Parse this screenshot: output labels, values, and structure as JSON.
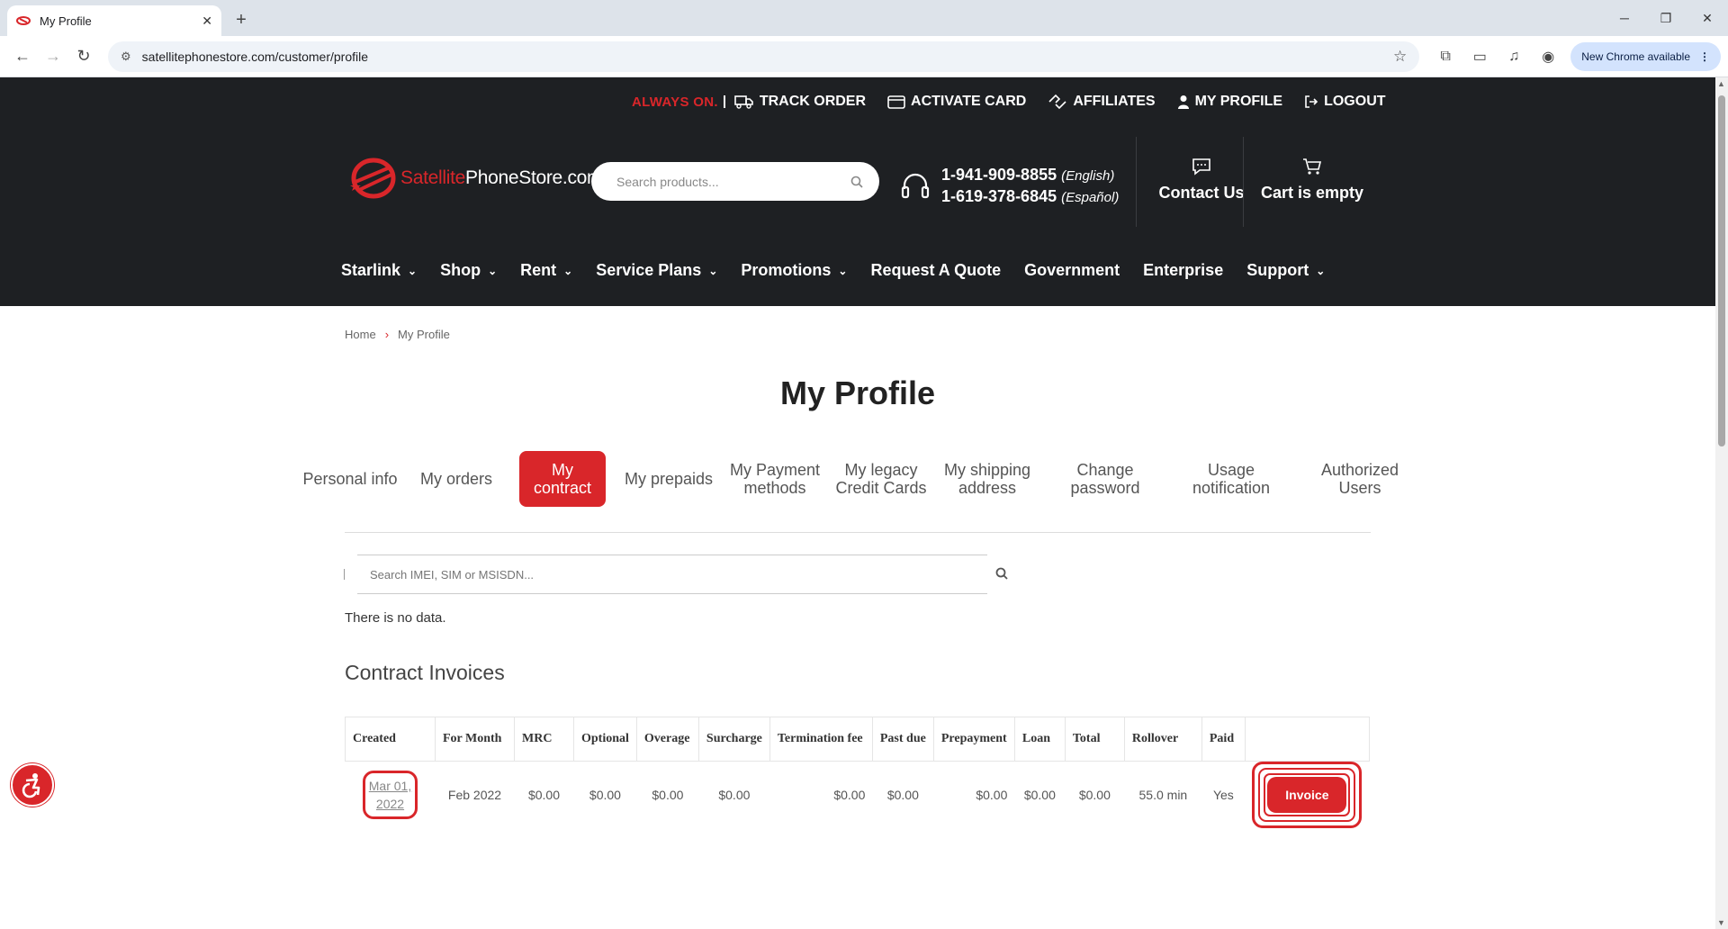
{
  "browser": {
    "tab_title": "My Profile",
    "url": "satellitephonestore.com/customer/profile",
    "new_chrome_label": "New Chrome available"
  },
  "topbar": {
    "always_on": "ALWAYS ON.",
    "links": [
      "TRACK ORDER",
      "ACTIVATE CARD",
      "AFFILIATES",
      "MY PROFILE",
      "LOGOUT"
    ]
  },
  "logo": {
    "part1": "Satellite",
    "part2": "PhoneStore.com"
  },
  "search": {
    "placeholder": "Search products..."
  },
  "phones": {
    "english_number": "1-941-909-8855",
    "english_label": "(English)",
    "spanish_number": "1-619-378-6845",
    "spanish_label": "(Español)"
  },
  "header_links": {
    "contact": "Contact Us",
    "cart": "Cart is empty"
  },
  "mainnav": [
    "Starlink",
    "Shop",
    "Rent",
    "Service Plans",
    "Promotions",
    "Request A Quote",
    "Government",
    "Enterprise",
    "Support"
  ],
  "breadcrumb": {
    "home": "Home",
    "current": "My Profile"
  },
  "page_title": "My Profile",
  "profile_tabs": [
    "Personal info",
    "My orders",
    "My contract",
    "My prepaids",
    "My Payment methods",
    "My legacy Credit Cards",
    "My shipping address",
    "Change password",
    "Usage notification",
    "Authorized Users"
  ],
  "imei_search": {
    "placeholder": "Search IMEI, SIM or MSISDN..."
  },
  "no_data": "There is no data.",
  "invoices": {
    "title": "Contract Invoices",
    "columns": [
      "Created",
      "For Month",
      "MRC",
      "Optional",
      "Overage",
      "Surcharge",
      "Termination fee",
      "Past due",
      "Prepayment",
      "Loan",
      "Total",
      "Rollover",
      "Paid",
      ""
    ],
    "rows": [
      {
        "created_line1": "Mar 01,",
        "created_line2": "2022",
        "for_month": "Feb 2022",
        "mrc": "$0.00",
        "optional": "$0.00",
        "overage": "$0.00",
        "surcharge": "$0.00",
        "termination_fee": "$0.00",
        "past_due": "$0.00",
        "prepayment": "$0.00",
        "loan": "$0.00",
        "total": "$0.00",
        "rollover": "55.0 min",
        "paid": "Yes",
        "invoice_label": "Invoice"
      }
    ]
  },
  "colors": {
    "brand_red": "#d9262a",
    "header_bg": "#1e2023"
  }
}
